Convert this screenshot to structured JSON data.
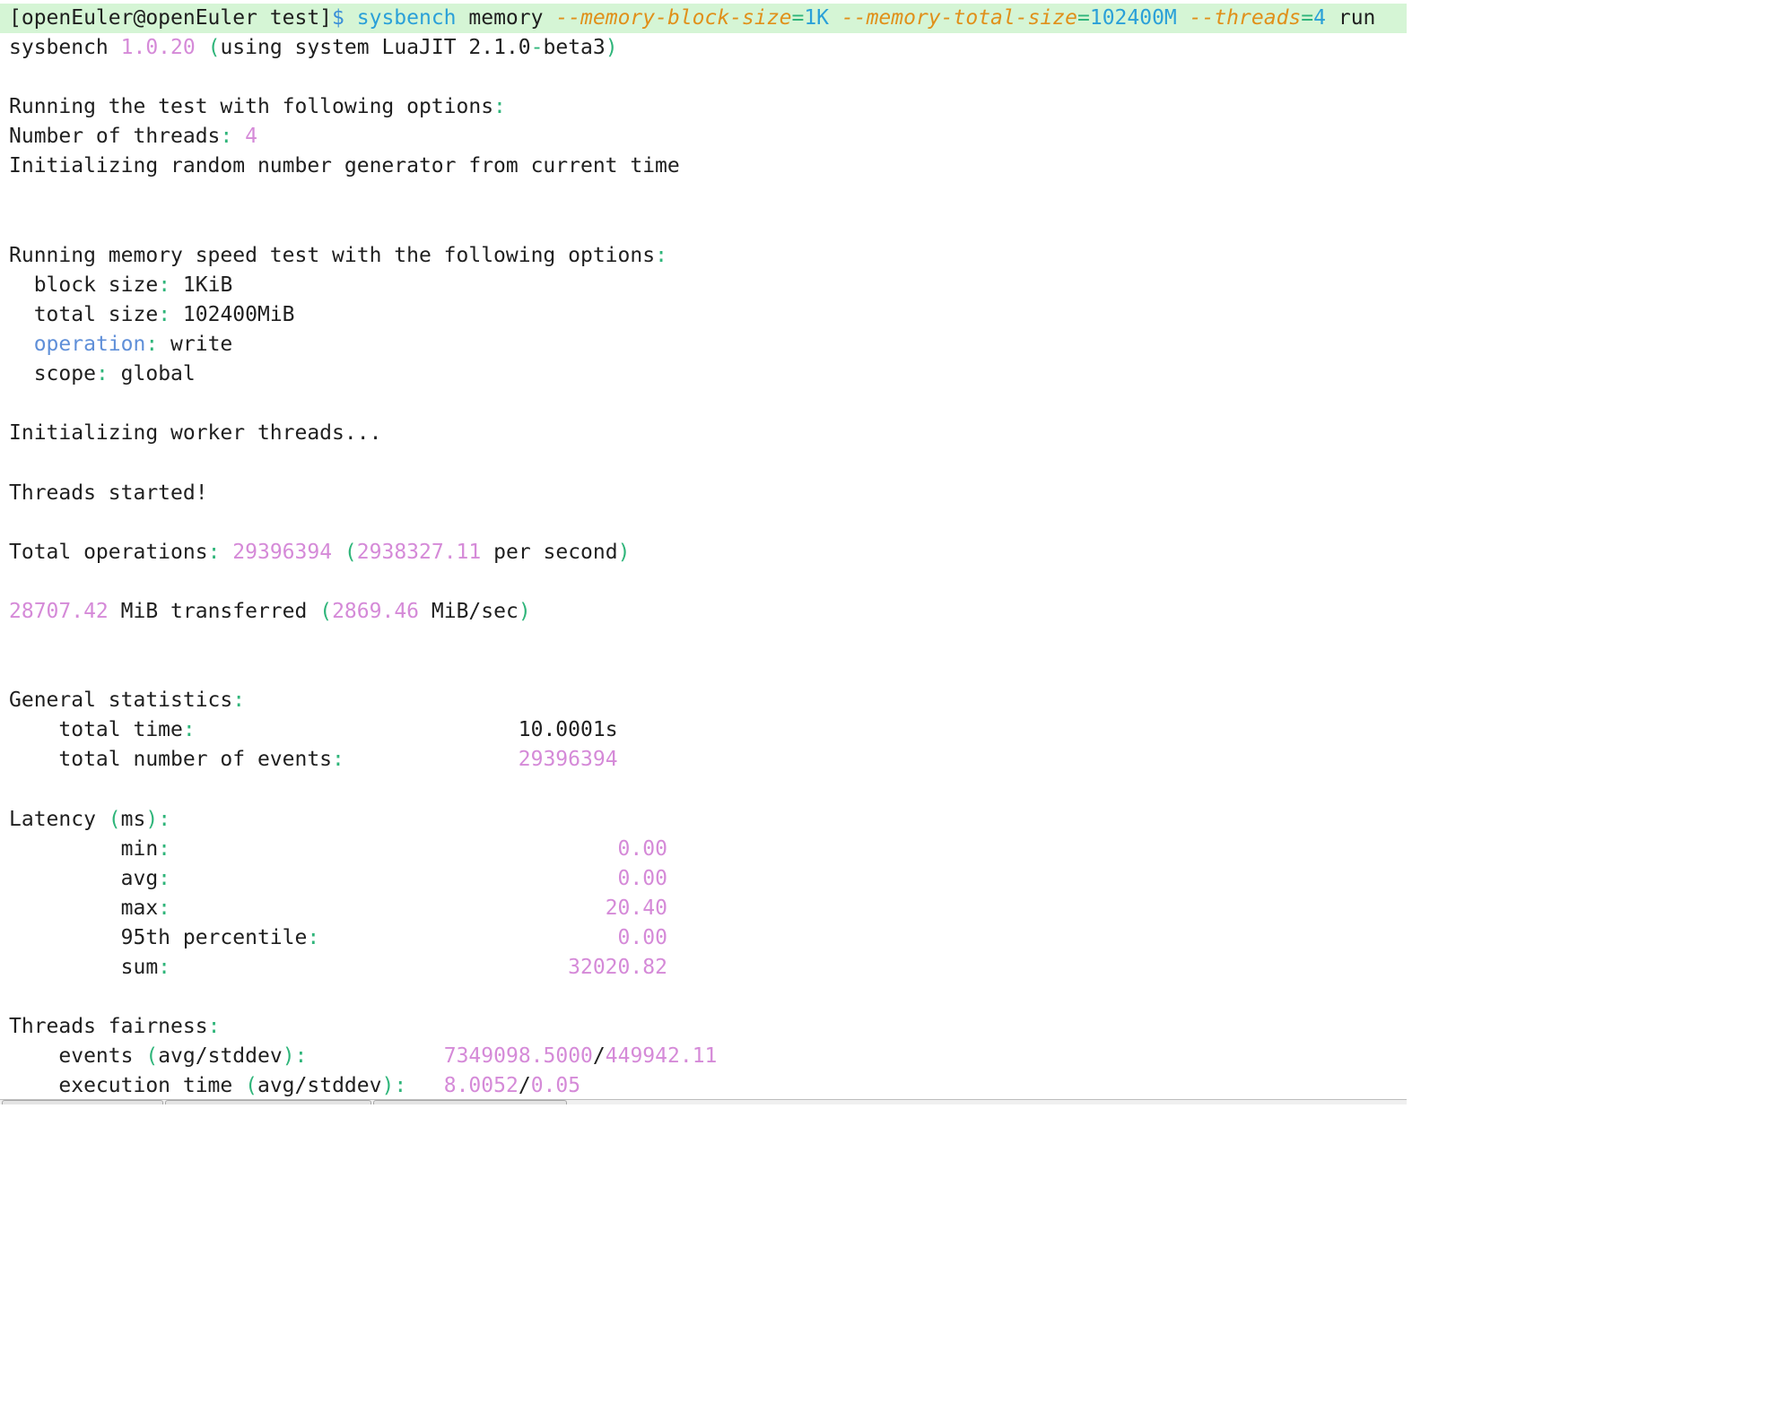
{
  "command": {
    "prompt": "[openEuler@openEuler test]",
    "prompt_symbol": "$",
    "program": "sysbench",
    "arg_memory": "memory",
    "opt1_flag": "--memory-block-size",
    "opt1_eq": "=",
    "opt1_val": "1K",
    "opt2_flag": "--memory-total-size",
    "opt2_eq": "=",
    "opt2_val": "102400M",
    "opt3_flag": "--threads",
    "opt3_eq": "=",
    "opt3_val": "4",
    "arg_run": "run"
  },
  "version": {
    "name": "sysbench",
    "number": "1.0.20",
    "paren_open": "(",
    "using": "using system LuaJIT 2.1.0",
    "dash": "-",
    "beta": "beta3",
    "paren_close": ")"
  },
  "options_header": "Running the test with following options",
  "threads": {
    "label": "Number of threads",
    "value": "4"
  },
  "rng_init": "Initializing random number generator from current time",
  "memory_header": "Running memory speed test with the following options",
  "memory_options": {
    "block_size": {
      "label": "block size",
      "value": "1KiB"
    },
    "total_size": {
      "label": "total size",
      "value": "102400MiB"
    },
    "operation": {
      "label": "operation",
      "value": "write"
    },
    "scope": {
      "label": "scope",
      "value": "global"
    }
  },
  "init_workers": "Initializing worker threads...",
  "threads_started": "Threads started!",
  "total_ops": {
    "label": "Total operations",
    "count": "29396394",
    "rate": "2938327.11",
    "suffix": "per second"
  },
  "transferred": {
    "amount": "28707.42",
    "mid": "MiB transferred",
    "rate": "2869.46",
    "unit": "MiB/sec"
  },
  "general_stats": {
    "header": "General statistics",
    "total_time": {
      "label": "total time",
      "value": "10.0001s"
    },
    "total_events": {
      "label": "total number of events",
      "value": "29396394"
    }
  },
  "latency": {
    "header_label": "Latency",
    "header_unit": "ms",
    "min": {
      "label": "min",
      "value": "0.00"
    },
    "avg": {
      "label": "avg",
      "value": "0.00"
    },
    "max": {
      "label": "max",
      "value": "20.40"
    },
    "p95": {
      "label": "95th percentile",
      "value": "0.00"
    },
    "sum": {
      "label": "sum",
      "value": "32020.82"
    }
  },
  "fairness": {
    "header": "Threads fairness",
    "events": {
      "label": "events",
      "paren_label": "avg/stddev",
      "avg": "7349098.5000",
      "stddev": "449942.11"
    },
    "exec_time": {
      "label": "execution time",
      "paren_label": "avg/stddev",
      "avg": "8.0052",
      "stddev": "0.05"
    }
  },
  "punct": {
    "colon": ":",
    "slash": "/",
    "open": "(",
    "close": ")"
  },
  "colors": {
    "punctuation_green": "#2fb57a",
    "number_magenta": "#d58ad8",
    "command_blue": "#3a8fd8",
    "option_orange": "#e0901a",
    "command_line_bg": "#d5f5d5"
  }
}
